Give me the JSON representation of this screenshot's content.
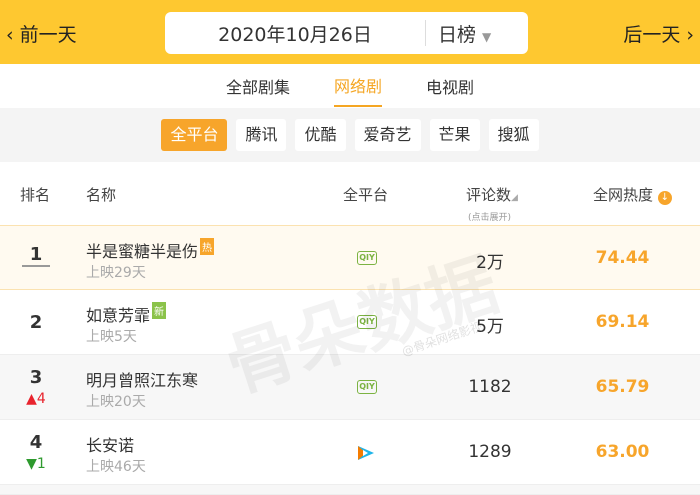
{
  "top": {
    "prev": "前一天",
    "next": "后一天",
    "date": "2020年10月26日",
    "rank_type": "日榜",
    "dropdown_icon": "▼"
  },
  "tabs": [
    {
      "label": "全部剧集",
      "active": false
    },
    {
      "label": "网络剧",
      "active": true
    },
    {
      "label": "电视剧",
      "active": false
    }
  ],
  "platforms": [
    {
      "label": "全平台",
      "active": true
    },
    {
      "label": "腾讯"
    },
    {
      "label": "优酷"
    },
    {
      "label": "爱奇艺"
    },
    {
      "label": "芒果"
    },
    {
      "label": "搜狐"
    }
  ],
  "header": {
    "rank": "排名",
    "name": "名称",
    "platform": "全平台",
    "comments": "评论数",
    "comments_note": "(点击展开)",
    "heat": "全网热度"
  },
  "rows": [
    {
      "rank": "1",
      "change": "",
      "name": "半是蜜糖半是伤",
      "badge": "热",
      "days": "上映29天",
      "platform": "iQIYI",
      "comments": "2万",
      "heat": "74.44"
    },
    {
      "rank": "2",
      "change": "",
      "name": "如意芳霏",
      "badge": "新",
      "days": "上映5天",
      "platform": "iQIYI",
      "comments": "5万",
      "heat": "69.14"
    },
    {
      "rank": "3",
      "change": "4",
      "change_dir": "up",
      "name": "明月曾照江东寒",
      "days": "上映20天",
      "platform": "iQIYI",
      "comments": "1182",
      "heat": "65.79"
    },
    {
      "rank": "4",
      "change": "1",
      "change_dir": "down",
      "name": "长安诺",
      "days": "上映46天",
      "platform": "Tencent Video",
      "comments": "1289",
      "heat": "63.00"
    }
  ],
  "watermark": {
    "main": "骨朵数据",
    "sub": "@骨朵网络影视"
  },
  "colors": {
    "top_bar": "#fec830",
    "accent": "#f7a52b",
    "up": "#e8232d",
    "down": "#2e9a2e",
    "hot_badge": "#f7a52b",
    "new_badge": "#8bc34a"
  }
}
